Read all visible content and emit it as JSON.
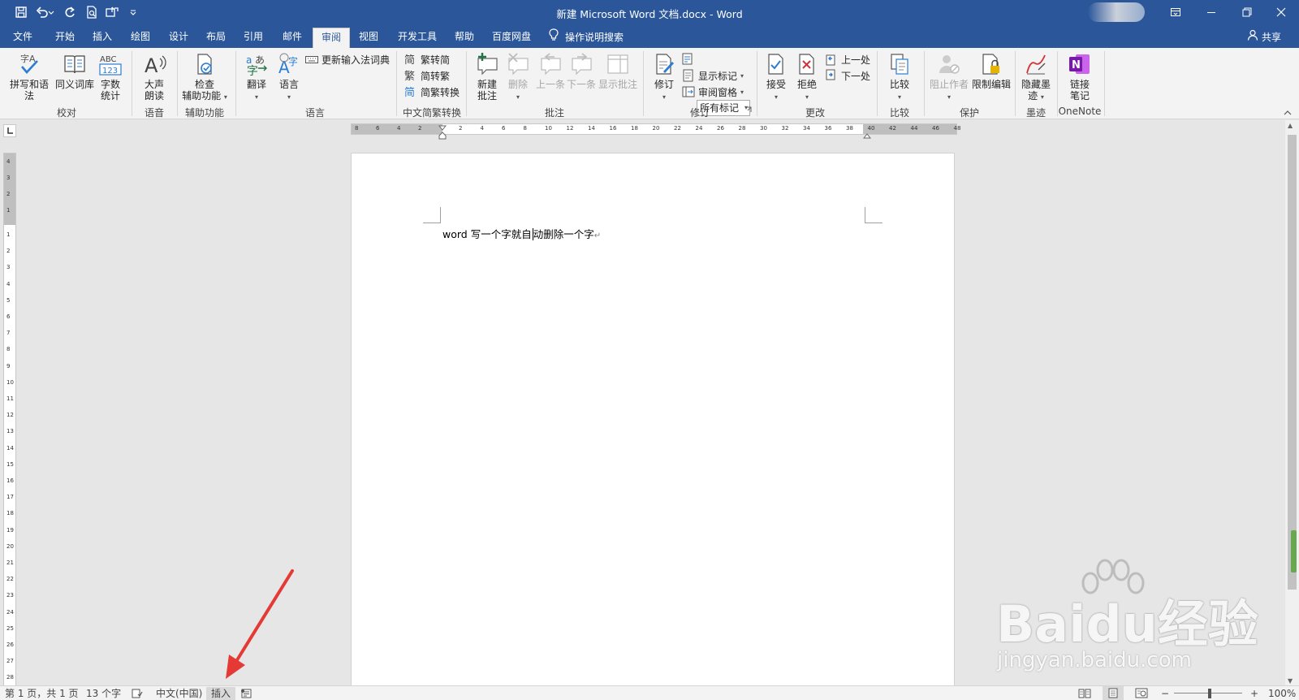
{
  "window": {
    "title": "新建 Microsoft Word 文档.docx  -  Word",
    "controls": [
      "ribbon-display-icon",
      "minimize-icon",
      "restore-icon",
      "close-icon"
    ]
  },
  "quick_access": [
    "save-icon",
    "undo-icon",
    "redo-icon",
    "print-preview-icon",
    "touch-mode-icon",
    "customize-qat-icon"
  ],
  "tabs": [
    {
      "label": "文件",
      "active": false
    },
    {
      "label": "开始",
      "active": false
    },
    {
      "label": "插入",
      "active": false
    },
    {
      "label": "绘图",
      "active": false
    },
    {
      "label": "设计",
      "active": false
    },
    {
      "label": "布局",
      "active": false
    },
    {
      "label": "引用",
      "active": false
    },
    {
      "label": "邮件",
      "active": false
    },
    {
      "label": "审阅",
      "active": true
    },
    {
      "label": "视图",
      "active": false
    },
    {
      "label": "开发工具",
      "active": false
    },
    {
      "label": "帮助",
      "active": false
    },
    {
      "label": "百度网盘",
      "active": false
    }
  ],
  "tell_me": "操作说明搜索",
  "share": "共享",
  "ribbon": {
    "proofing": {
      "label": "校对",
      "spelling": "拼写和语法",
      "thesaurus": "同义词库",
      "word_count_1": "字数",
      "word_count_2": "统计"
    },
    "speech": {
      "label": "语音",
      "read_aloud_1": "大声",
      "read_aloud_2": "朗读"
    },
    "accessibility": {
      "label": "辅助功能",
      "check_1": "检查",
      "check_2": "辅助功能"
    },
    "language": {
      "label": "语言",
      "translate": "翻译",
      "language": "语言",
      "update_ime": "更新输入法词典"
    },
    "chinese_conversion": {
      "label": "中文简繁转换",
      "to_simplified": "繁转简",
      "to_traditional": "简转繁",
      "convert": "简繁转换"
    },
    "comments": {
      "label": "批注",
      "new_1": "新建",
      "new_2": "批注",
      "delete": "删除",
      "previous": "上一条",
      "next": "下一条",
      "show": "显示批注"
    },
    "tracking": {
      "label": "修订",
      "track": "修订",
      "markup_combo": "所有标记",
      "show_markup": "显示标记",
      "reviewing_pane": "审阅窗格"
    },
    "changes": {
      "label": "更改",
      "accept": "接受",
      "reject": "拒绝",
      "previous": "上一处",
      "next": "下一处"
    },
    "compare": {
      "label": "比较",
      "compare": "比较"
    },
    "protect": {
      "label": "保护",
      "block_authors": "阻止作者",
      "restrict": "限制编辑"
    },
    "ink": {
      "label": "墨迹",
      "hide_ink_1": "隐藏墨",
      "hide_ink_2": "迹"
    },
    "onenote": {
      "label": "OneNote",
      "linked_1": "链接",
      "linked_2": "笔记"
    }
  },
  "ruler": {
    "h_left": [
      "8",
      "6",
      "4",
      "2"
    ],
    "h_right": [
      "2",
      "4",
      "6",
      "8",
      "10",
      "12",
      "14",
      "16",
      "18",
      "20",
      "22",
      "24",
      "26",
      "28",
      "30",
      "32",
      "34",
      "36",
      "38",
      "40",
      "42",
      "44",
      "46",
      "48"
    ],
    "v_top": [
      "4",
      "3",
      "2",
      "1"
    ],
    "v_body": [
      "1",
      "2",
      "3",
      "4",
      "5",
      "6",
      "7",
      "8",
      "9",
      "10",
      "11",
      "12",
      "13",
      "14",
      "15",
      "16",
      "17",
      "18",
      "19",
      "20",
      "21",
      "22",
      "23",
      "24",
      "25",
      "26",
      "27",
      "28"
    ]
  },
  "document": {
    "before_cursor": "word 写一个字就自",
    "after_cursor": "动删除一个字",
    "paragraph_mark": "↵"
  },
  "status": {
    "page": "第 1 页，共 1 页",
    "words": "13 个字",
    "language": "中文(中国)",
    "mode": "插入",
    "zoom": "100%",
    "zoom_minus": "−",
    "zoom_plus": "+"
  },
  "watermark": {
    "main": "Baidu经验",
    "sub": "jingyan.baidu.com"
  },
  "colors": {
    "title_bar": "#2b579a",
    "accent": "#2b579a",
    "annotation_arrow": "#e53935"
  }
}
